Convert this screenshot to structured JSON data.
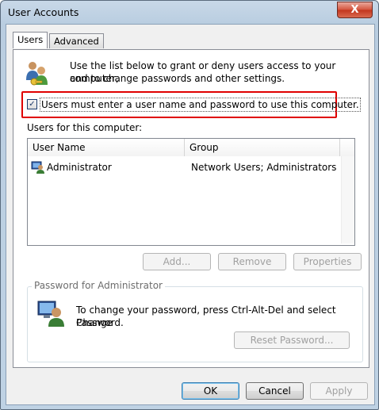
{
  "window": {
    "title": "User Accounts",
    "close_glyph": "X"
  },
  "tabs": [
    {
      "label": "Users",
      "active": true
    },
    {
      "label": "Advanced",
      "active": false
    }
  ],
  "intro": {
    "line1": "Use the list below to grant or deny users access to your computer,",
    "line2": "and to change passwords and other settings."
  },
  "checkbox": {
    "label": "Users must enter a user name and password to use this computer.",
    "checked": true,
    "mark": "✓"
  },
  "users_label": "Users for this computer:",
  "table": {
    "columns": [
      "User Name",
      "Group"
    ],
    "rows": [
      {
        "user": "Administrator",
        "group": "Network Users; Administrators"
      }
    ]
  },
  "list_buttons": {
    "add": "Add...",
    "remove": "Remove",
    "properties": "Properties"
  },
  "password_group": {
    "title": "Password for Administrator",
    "line1": "To change your password, press Ctrl-Alt-Del and select Change",
    "line2": "Password.",
    "reset_button": "Reset Password..."
  },
  "footer": {
    "ok": "OK",
    "cancel": "Cancel",
    "apply": "Apply"
  },
  "colors": {
    "highlight": "#e00000",
    "title_bar": "#bfd2e4",
    "close_button": "#c2351d"
  }
}
